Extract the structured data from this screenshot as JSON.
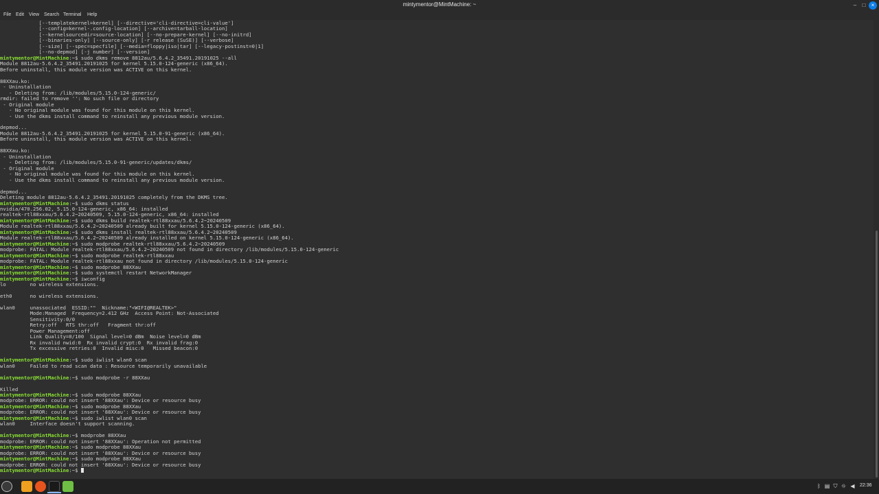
{
  "window": {
    "title": "mintymentor@MintMachine: ~",
    "minimize_glyph": "–",
    "maximize_glyph": "□",
    "close_glyph": "×"
  },
  "menu": [
    "File",
    "Edit",
    "View",
    "Search",
    "Terminal",
    "Help"
  ],
  "terminal": {
    "prompt": "mintymentor@MintMachine",
    "prompt_suffix": ":~$ ",
    "prompt_color": "#8ae234",
    "text_color": "#d3d3d3",
    "background": "#2f2f2f",
    "lines": [
      {
        "t": "             [--templatekernel=kernel] [--directive='cli-directive=cli-value']"
      },
      {
        "t": "             [--config=kernel-.config-location] [--archive=tarball-location]"
      },
      {
        "t": "             [--kernelsourcedir=source-location] [--no-prepare-kernel] [--no-initrd]"
      },
      {
        "t": "             [--binaries-only] [--source-only] [-r release (SuSE)] [--verbose]"
      },
      {
        "t": "             [--size] [--spec=specfile] [--media=floppy|iso|tar] [--legacy-postinst=0|1]"
      },
      {
        "t": "             [--no-depmod] [-j number] [--version]"
      },
      {
        "p": 1,
        "t": "sudo dkms remove 8812au/5.6.4.2_35491.20191025 --all"
      },
      {
        "t": "Module 8812au-5.6.4.2_35491.20191025 for kernel 5.15.0-124-generic (x86_64)."
      },
      {
        "t": "Before uninstall, this module version was ACTIVE on this kernel."
      },
      {
        "t": ""
      },
      {
        "t": "88XXau.ko:"
      },
      {
        "t": " - Uninstallation"
      },
      {
        "t": "   - Deleting from: /lib/modules/5.15.0-124-generic/"
      },
      {
        "t": "rmdir: failed to remove '': No such file or directory"
      },
      {
        "t": " - Original module"
      },
      {
        "t": "   - No original module was found for this module on this kernel."
      },
      {
        "t": "   - Use the dkms install command to reinstall any previous module version."
      },
      {
        "t": ""
      },
      {
        "t": "depmod..."
      },
      {
        "t": "Module 8812au-5.6.4.2_35491.20191025 for kernel 5.15.0-91-generic (x86_64)."
      },
      {
        "t": "Before uninstall, this module version was ACTIVE on this kernel."
      },
      {
        "t": ""
      },
      {
        "t": "88XXau.ko:"
      },
      {
        "t": " - Uninstallation"
      },
      {
        "t": "   - Deleting from: /lib/modules/5.15.0-91-generic/updates/dkms/"
      },
      {
        "t": " - Original module"
      },
      {
        "t": "   - No original module was found for this module on this kernel."
      },
      {
        "t": "   - Use the dkms install command to reinstall any previous module version."
      },
      {
        "t": ""
      },
      {
        "t": "depmod..."
      },
      {
        "t": "Deleting module 8812au-5.6.4.2_35491.20191025 completely from the DKMS tree."
      },
      {
        "p": 1,
        "t": "sudo dkms status"
      },
      {
        "t": "nvidia/470.256.02, 5.15.0-124-generic, x86_64: installed"
      },
      {
        "t": "realtek-rtl88xxau/5.6.4.2~20240509, 5.15.0-124-generic, x86_64: installed"
      },
      {
        "p": 1,
        "t": "sudo dkms build realtek-rtl88xxau/5.6.4.2~20240509"
      },
      {
        "t": "Module realtek-rtl88xxau/5.6.4.2~20240509 already built for kernel 5.15.0-124-generic (x86_64)."
      },
      {
        "p": 1,
        "t": "sudo dkms install realtek-rtl88xxau/5.6.4.2~20240509"
      },
      {
        "t": "Module realtek-rtl88xxau/5.6.4.2~20240509 already installed on kernel 5.15.0-124-generic (x86_64)."
      },
      {
        "p": 1,
        "t": "sudo modprobe realtek-rtl88xxau/5.6.4.2~20240509"
      },
      {
        "t": "modprobe: FATAL: Module realtek-rtl88xxau/5.6.4.2~20240509 not found in directory /lib/modules/5.15.0-124-generic"
      },
      {
        "p": 1,
        "t": "sudo modprobe realtek-rtl88xxau"
      },
      {
        "t": "modprobe: FATAL: Module realtek-rtl88xxau not found in directory /lib/modules/5.15.0-124-generic"
      },
      {
        "p": 1,
        "t": "sudo modprobe 88XXau"
      },
      {
        "p": 1,
        "t": "sudo systemctl restart NetworkManager"
      },
      {
        "p": 1,
        "t": "iwconfig"
      },
      {
        "t": "lo        no wireless extensions."
      },
      {
        "t": ""
      },
      {
        "t": "eth0      no wireless extensions."
      },
      {
        "t": ""
      },
      {
        "t": "wlan0     unassociated  ESSID:\"\"  Nickname:\"<WIFI@REALTEK>\""
      },
      {
        "t": "          Mode:Managed  Frequency=2.412 GHz  Access Point: Not-Associated"
      },
      {
        "t": "          Sensitivity:0/0"
      },
      {
        "t": "          Retry:off   RTS thr:off   Fragment thr:off"
      },
      {
        "t": "          Power Management:off"
      },
      {
        "t": "          Link Quality=0/100  Signal level=0 dBm  Noise level=0 dBm"
      },
      {
        "t": "          Rx invalid nwid:0  Rx invalid crypt:0  Rx invalid frag:0"
      },
      {
        "t": "          Tx excessive retries:0  Invalid misc:0   Missed beacon:0"
      },
      {
        "t": ""
      },
      {
        "p": 1,
        "t": "sudo iwlist wlan0 scan"
      },
      {
        "t": "wlan0     Failed to read scan data : Resource temporarily unavailable"
      },
      {
        "t": ""
      },
      {
        "p": 1,
        "t": "sudo modprobe -r 88XXau"
      },
      {
        "t": ""
      },
      {
        "t": "Killed"
      },
      {
        "p": 1,
        "t": "sudo modprobe 88XXau"
      },
      {
        "t": "modprobe: ERROR: could not insert '88XXau': Device or resource busy"
      },
      {
        "p": 1,
        "t": "sudo modprobe 88XXau"
      },
      {
        "t": "modprobe: ERROR: could not insert '88XXau': Device or resource busy"
      },
      {
        "p": 1,
        "t": "sudo iwlist wlan0 scan"
      },
      {
        "t": "wlan0     Interface doesn't support scanning."
      },
      {
        "t": ""
      },
      {
        "p": 1,
        "t": "modprobe 88XXau"
      },
      {
        "t": "modprobe: ERROR: could not insert '88XXau': Operation not permitted"
      },
      {
        "p": 1,
        "t": "sudo modprobe 88XXau"
      },
      {
        "t": "modprobe: ERROR: could not insert '88XXau': Device or resource busy"
      },
      {
        "p": 1,
        "t": "sudo modprobe 88XXau"
      },
      {
        "t": "modprobe: ERROR: could not insert '88XXau': Device or resource busy"
      },
      {
        "p": 1,
        "t": "",
        "cursor": 1
      }
    ]
  },
  "taskbar": {
    "apps": [
      {
        "name": "menu-icon"
      },
      {
        "name": "files-icon"
      },
      {
        "name": "firefox-icon"
      },
      {
        "name": "terminal-icon"
      },
      {
        "name": "mint-update-icon"
      }
    ],
    "tray": [
      {
        "name": "bluetooth-icon",
        "glyph": "ᛒ"
      },
      {
        "name": "clipboard-icon",
        "glyph": "▤"
      },
      {
        "name": "shield-icon",
        "glyph": "⛉"
      },
      {
        "name": "network-icon",
        "glyph": "⛗"
      },
      {
        "name": "volume-icon",
        "glyph": "◀"
      },
      {
        "name": "battery-icon",
        "glyph": "▮"
      }
    ],
    "clock": "22:36"
  }
}
